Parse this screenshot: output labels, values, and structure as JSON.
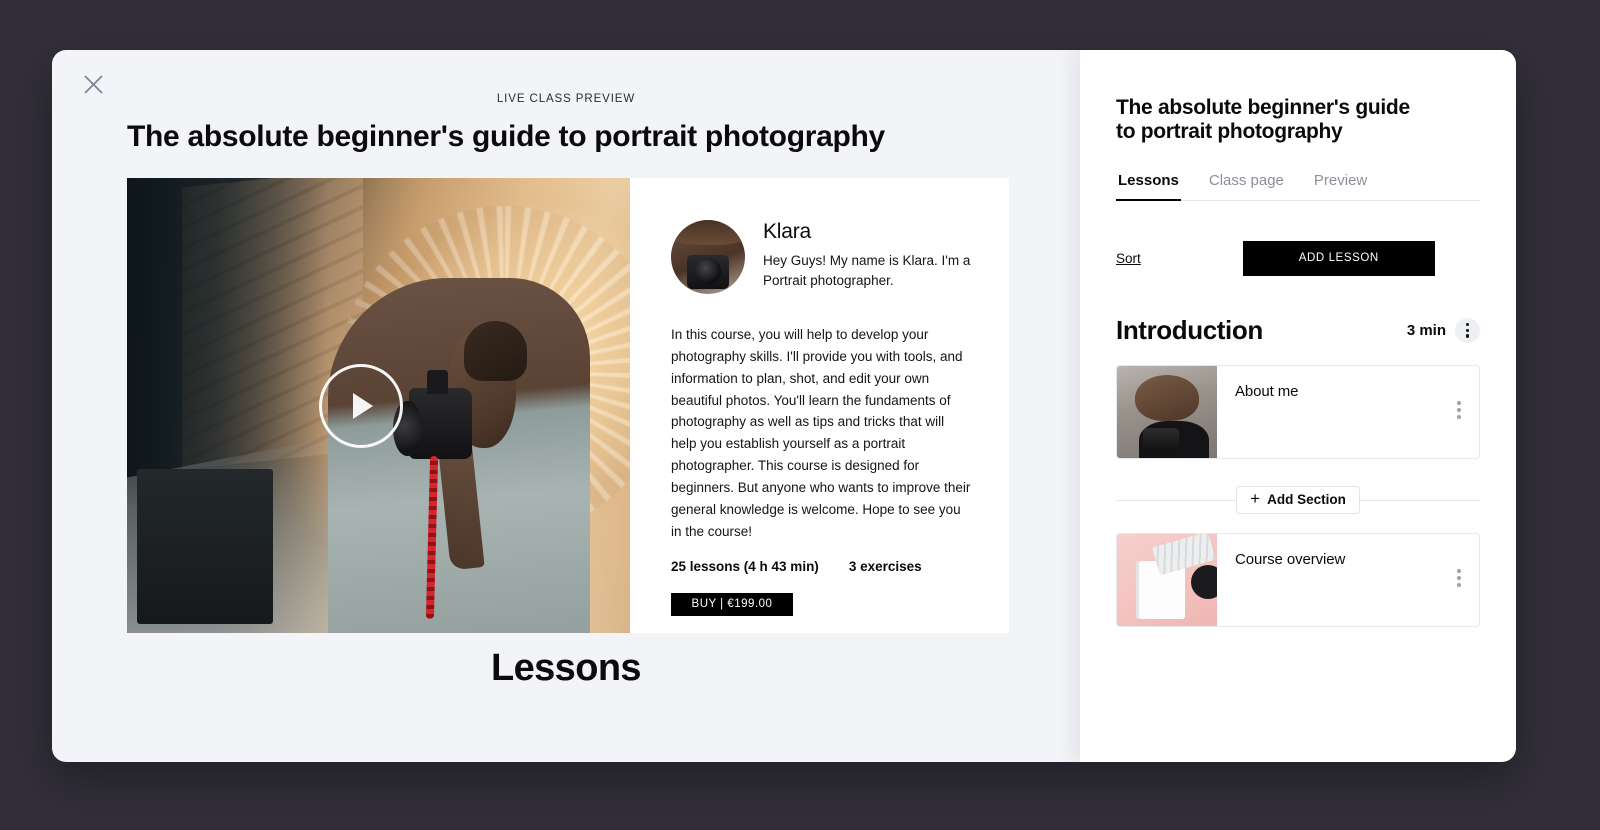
{
  "theme": {
    "backdrop": "#322F3A",
    "preview_bg": "#F2F4F7",
    "panel_bg": "#FFFFFF",
    "accent": "#000000",
    "muted_text": "#8A8F98"
  },
  "preview": {
    "close_icon": "close-icon",
    "eyebrow": "LIVE CLASS PREVIEW",
    "title": "The absolute beginner's guide to portrait photography",
    "play_icon": "play-icon",
    "author": {
      "name": "Klara",
      "bio": "Hey Guys! My name is Klara. I'm a Portrait photographer.",
      "avatar_alt": "avatar"
    },
    "description": "In this course, you will help to develop your photography skills. I'll provide you with tools, and information to plan, shot, and edit your own beautiful photos. You'll learn the fundaments of photography as well as tips and tricks that will help you establish yourself as a portrait photographer. This course is designed for beginners. But anyone who wants to improve their general knowledge is welcome. Hope to see you in the course!",
    "stats": {
      "lessons": "25 lessons (4 h 43 min)",
      "exercises": "3 exercises"
    },
    "buy_label": "BUY | €199.00",
    "lessons_heading": "Lessons"
  },
  "editor": {
    "title": "The absolute beginner's guide to portrait photography",
    "tabs": [
      {
        "label": "Lessons",
        "active": true
      },
      {
        "label": "Class page",
        "active": false
      },
      {
        "label": "Preview",
        "active": false
      }
    ],
    "toolbar": {
      "sort_label": "Sort",
      "add_lesson_label": "ADD LESSON"
    },
    "section": {
      "name": "Introduction",
      "duration": "3 min",
      "menu_icon": "kebab-menu-icon"
    },
    "lessons": [
      {
        "title": "About me",
        "menu_icon": "kebab-menu-icon",
        "thumb": "thumb-a"
      },
      {
        "title": "Course overview",
        "menu_icon": "kebab-menu-icon",
        "thumb": "thumb-b"
      }
    ],
    "add_section": {
      "icon": "plus-icon",
      "label": "Add Section"
    }
  }
}
